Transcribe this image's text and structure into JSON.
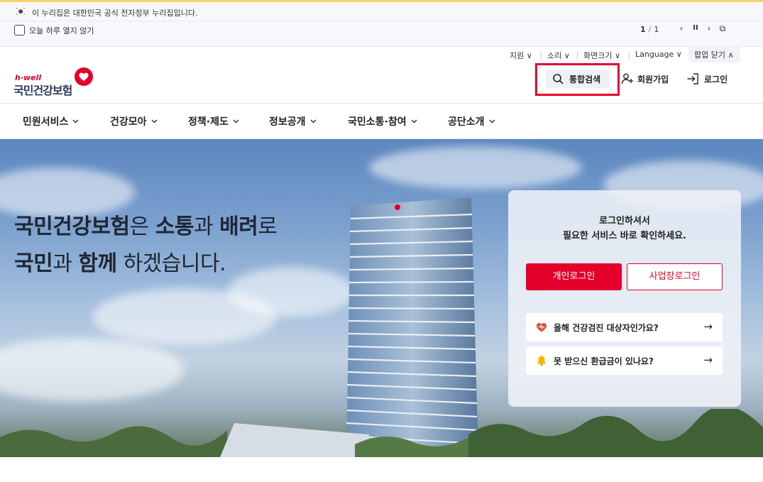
{
  "gov_banner": {
    "text": "이 누리집은 대한민국 공식 전자정부 누리집입니다."
  },
  "popup": {
    "dont_show_label": "오늘 하루 열지 않기",
    "pager_current": "1",
    "pager_sep": "/",
    "pager_total": "1",
    "prev": "‹",
    "pause": "II",
    "next": "›",
    "copy": "⧉"
  },
  "utility": {
    "support": "지원 ∨",
    "sound": "소리 ∨",
    "screen_size": "화면크기 ∨",
    "language": "Language ∨",
    "close_popup": "팝업 닫기 ∧"
  },
  "logo": {
    "tagline": "h·well",
    "name": "국민건강보험"
  },
  "header": {
    "search_label": "통합검색",
    "signup_label": "회원가입",
    "login_label": "로그인"
  },
  "gnb": [
    {
      "label": "민원서비스"
    },
    {
      "label": "건강모아"
    },
    {
      "label": "정책·제도"
    },
    {
      "label": "정보공개"
    },
    {
      "label": "국민소통·참여"
    },
    {
      "label": "공단소개"
    }
  ],
  "hero": {
    "line1_a": "국민건강보험",
    "line1_b": "은 ",
    "line1_c": "소통",
    "line1_d": "과 ",
    "line1_e": "배려",
    "line1_f": "로",
    "line2_a": "국민",
    "line2_b": "과 ",
    "line2_c": "함께",
    "line2_d": " 하겠습니다."
  },
  "login_card": {
    "msg_line1": "로그인하셔서",
    "msg_line2": "필요한 서비스 바로 확인하세요.",
    "personal_login": "개인로그인",
    "business_login": "사업장로그인",
    "quick1": "올해 건강검진 대상자인가요?",
    "quick2": "못 받으신 환급금이 있나요?",
    "arrow": "→"
  },
  "colors": {
    "brand_red": "#e4002b",
    "navy": "#2e3a55"
  }
}
